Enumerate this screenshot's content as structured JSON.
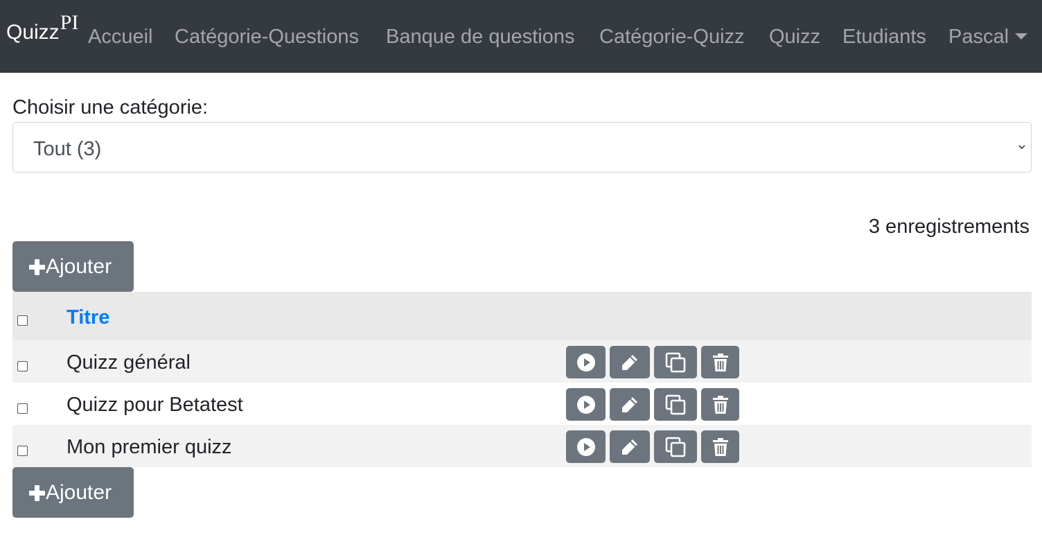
{
  "navbar": {
    "brand": "Quizz",
    "brand_suffix": "PI",
    "links": [
      "Accueil",
      "Catégorie-Questions",
      "Banque de questions",
      "Catégorie-Quizz",
      "Quizz",
      "Etudiants"
    ],
    "user": "Pascal"
  },
  "filter": {
    "label": "Choisir une catégorie:",
    "selected": "Tout (3)"
  },
  "count_text": "3 enregistrements",
  "add_label": "Ajouter",
  "table": {
    "column_title": "Titre",
    "rows": [
      {
        "title": "Quizz général"
      },
      {
        "title": "Quizz pour Betatest"
      },
      {
        "title": "Mon premier quizz"
      }
    ],
    "actions": [
      "play-icon",
      "pencil-icon",
      "copy-icon",
      "trash-icon"
    ]
  },
  "colors": {
    "navbar": "#343a40",
    "button": "#6c757d",
    "link": "#007bff"
  }
}
